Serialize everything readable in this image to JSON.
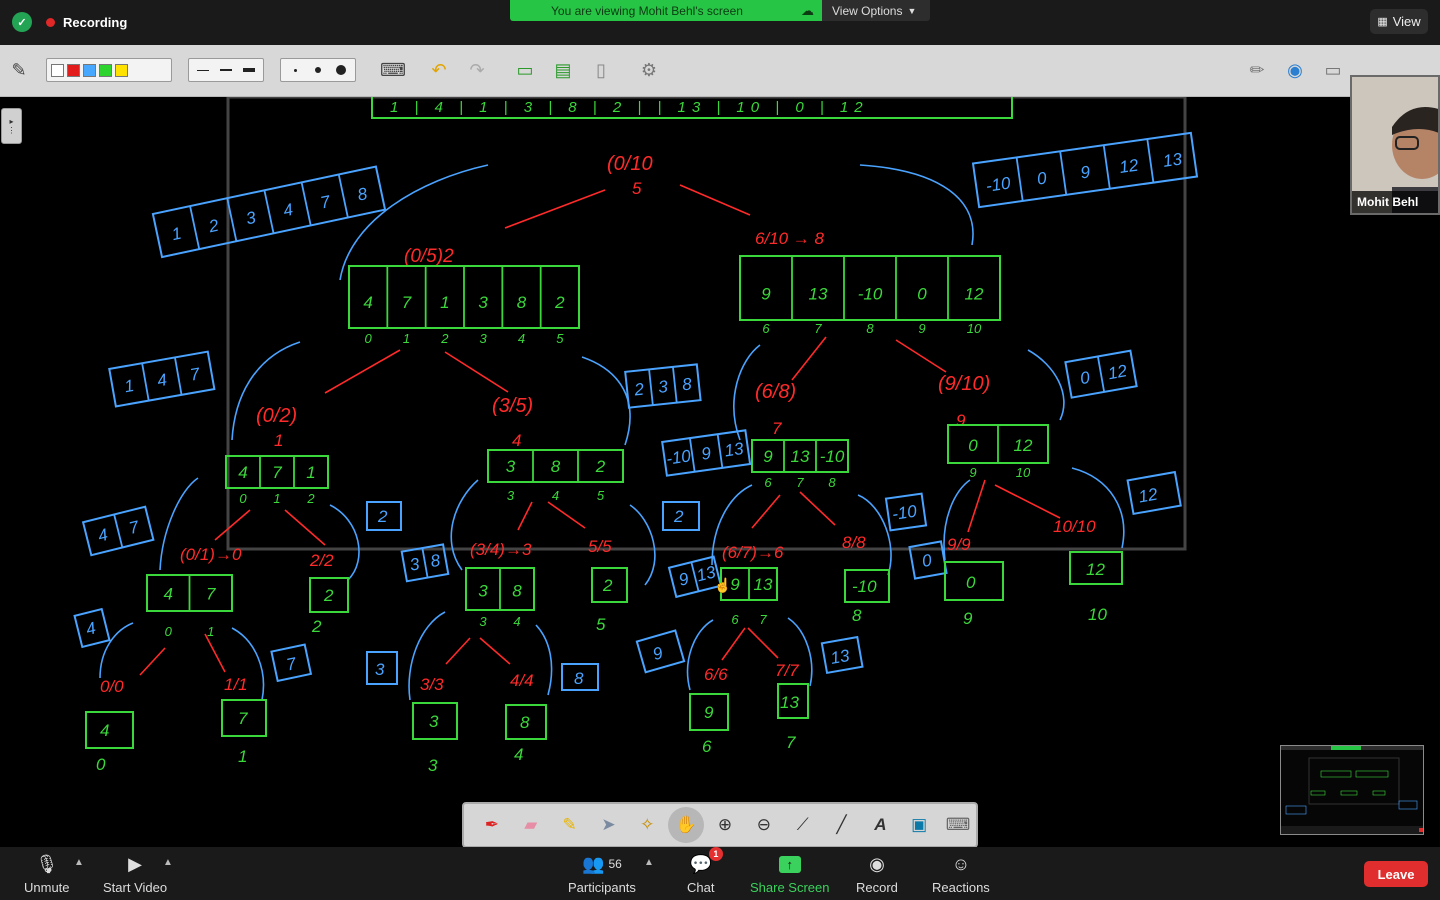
{
  "top": {
    "recording_label": "Recording",
    "viewing_banner": "You are viewing Mohit Behl's screen",
    "view_options_label": "View Options",
    "view_label": "View"
  },
  "participant": {
    "name": "Mohit Behl"
  },
  "whiteboard": {
    "red": {
      "n_root": "(0/10",
      "n_root_mid": "5",
      "n_left": "(0/5)2",
      "n_right": "6/10 → 8",
      "n_02": "(0/2)",
      "n_02_mid": "1",
      "n_35": "(3/5)",
      "n_35_mid": "4",
      "n_68": "(6/8)",
      "n_68_mid": "7",
      "n_910": "(9/10)",
      "n_910_mid": "9",
      "n_01": "(0/1)→0",
      "n_22": "2/2",
      "n_34": "(3/4)→3",
      "n_55": "5/5",
      "n_67": "(6/7)→6",
      "n_88": "8/8",
      "n_99": "9/9",
      "n_1010": "10/10",
      "n_00": "0/0",
      "n_11": "1/1",
      "n_33": "3/3",
      "n_44": "4/4",
      "n_66": "6/6",
      "n_77": "7/7"
    },
    "green": {
      "top_row": "1 | 4 | 1 | 3 | 8 | 2 | | 13 | 10 | 0 | 12",
      "arr_left": [
        "4",
        "7",
        "1",
        "3",
        "8",
        "2"
      ],
      "arr_left_idx": [
        "0",
        "1",
        "2",
        "3",
        "4",
        "5"
      ],
      "arr_right": [
        "9",
        "13",
        "-10",
        "0",
        "12"
      ],
      "arr_right_idx": [
        "6",
        "7",
        "8",
        "9",
        "10"
      ],
      "a_471": [
        "4",
        "7",
        "1"
      ],
      "a_471_idx": [
        "0",
        "1",
        "2"
      ],
      "a_382": [
        "3",
        "8",
        "2"
      ],
      "a_382_idx": [
        "3",
        "4",
        "5"
      ],
      "a_913": [
        "9",
        "13",
        "-10"
      ],
      "a_913_idx": [
        "6",
        "7",
        "8"
      ],
      "a_012": [
        "0",
        "12"
      ],
      "a_012_idx": [
        "9",
        "10"
      ],
      "a_47": [
        "4",
        "7"
      ],
      "a_47_idx": [
        "0",
        "1"
      ],
      "a_2": "2",
      "a_2_idx": "2",
      "a_38": [
        "3",
        "8"
      ],
      "a_38_idx": [
        "3",
        "4"
      ],
      "a_2b": "2",
      "a_2b_idx": "5",
      "a_9_13": [
        "9",
        "13"
      ],
      "a_9_13_idx": [
        "6",
        "7"
      ],
      "a_m10": "-10",
      "a_m10_idx": "8",
      "a_0": "0",
      "a_0_idx": "9",
      "a_12": "12",
      "a_12_idx": "10",
      "l_4": "4",
      "l_4_idx": "0",
      "l_7": "7",
      "l_7_idx": "1",
      "l_3": "3",
      "l_3_idx": "3",
      "l_8": "8",
      "l_8_idx": "4",
      "l_9": "9",
      "l_9_idx": "6",
      "l_13": "13",
      "l_13_idx": "7"
    },
    "blue": {
      "b_123478": [
        "1",
        "2",
        "3",
        "4",
        "7",
        "8"
      ],
      "b_right": [
        "-10",
        "0",
        "9",
        "12",
        "13"
      ],
      "b_147": [
        "1",
        "4",
        "7"
      ],
      "b_238": [
        "2",
        "3",
        "8"
      ],
      "b_m10913": [
        "-10",
        "9",
        "13"
      ],
      "b_012": [
        "0",
        "12"
      ],
      "b_47": [
        "4",
        "7"
      ],
      "b_2": "2",
      "b_38": [
        "3",
        "8"
      ],
      "b_2b": "2",
      "b_913": [
        "9",
        "13"
      ],
      "b_m10": "-10",
      "b_0": "0",
      "b_12": "12",
      "b_4": "4",
      "b_7": "7",
      "b_3": "3",
      "b_8": "8",
      "b_9": "9",
      "b_13": "13"
    }
  },
  "bottom": {
    "unmute_label": "Unmute",
    "start_video_label": "Start Video",
    "participants_label": "Participants",
    "participants_count": "56",
    "chat_label": "Chat",
    "chat_badge": "1",
    "share_label": "Share Screen",
    "record_label": "Record",
    "reactions_label": "Reactions",
    "leave_label": "Leave"
  },
  "icons": {
    "security": "shield-icon",
    "view": "grid-icon",
    "cloud": "cloud-icon",
    "annotate_tools": [
      "pen-icon",
      "eraser-icon",
      "highlighter-icon",
      "pointer-icon",
      "magic-wand-icon",
      "hand-icon",
      "zoom-in-icon",
      "zoom-out-icon",
      "brush-icon",
      "line-icon",
      "text-icon",
      "image-icon",
      "keyboard-icon"
    ]
  },
  "colors": {
    "green_banner": "#27c546",
    "leave": "#e02d2d",
    "chalk_red": "#ff2a2a",
    "chalk_green": "#3bd83b",
    "chalk_blue": "#4aa3ff"
  }
}
